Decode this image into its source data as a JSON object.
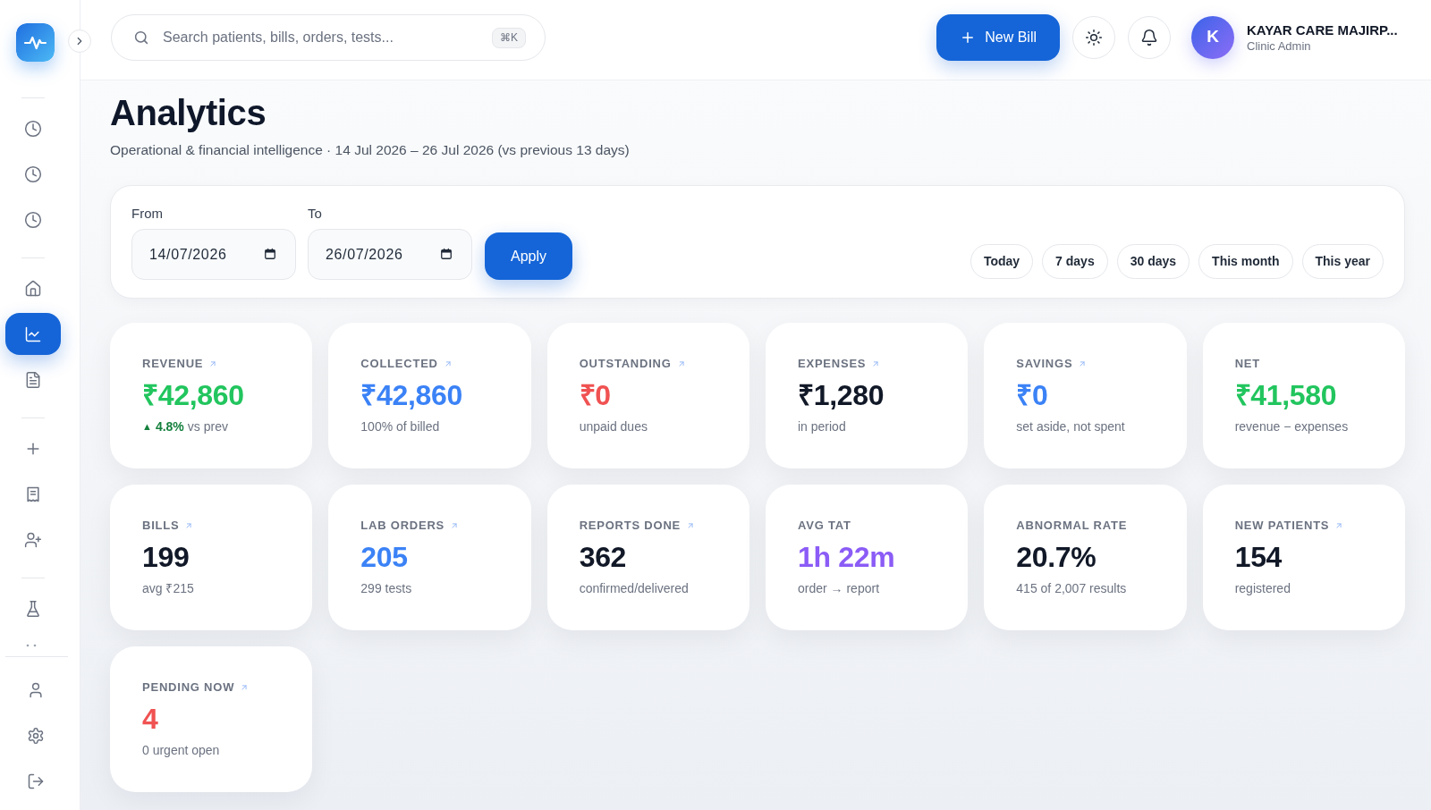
{
  "sidebar": {
    "groups": [
      {
        "items": [
          {
            "kind": "clock",
            "selected": false
          },
          {
            "kind": "clock",
            "selected": false
          },
          {
            "kind": "clock",
            "selected": false
          }
        ]
      },
      {
        "items": [
          {
            "kind": "home",
            "selected": false
          },
          {
            "kind": "chart",
            "selected": true
          },
          {
            "kind": "document",
            "selected": false
          }
        ]
      },
      {
        "items": [
          {
            "kind": "plus",
            "selected": false
          },
          {
            "kind": "receipt",
            "selected": false
          },
          {
            "kind": "adduser",
            "selected": false
          }
        ]
      },
      {
        "items": [
          {
            "kind": "flask",
            "selected": false
          }
        ]
      }
    ],
    "footer_items": [
      {
        "kind": "user",
        "selected": false
      },
      {
        "kind": "gear",
        "selected": false
      },
      {
        "kind": "logout",
        "selected": false
      }
    ]
  },
  "topbar": {
    "search": {
      "placeholder": "Search patients, bills, orders, tests...",
      "shortcut": "⌘K"
    },
    "new_bill_button": "New Bill",
    "user": {
      "initial": "K",
      "name": "KAYAR CARE MAJIRP...",
      "role": "Clinic Admin"
    }
  },
  "header": {
    "title": "Analytics",
    "subtitle": "Operational & financial intelligence · 14 Jul 2026 – 26 Jul 2026 (vs previous 13 days)"
  },
  "filters": {
    "from": {
      "label": "From",
      "value": "14/07/2026"
    },
    "to": {
      "label": "To",
      "value": "26/07/2026"
    },
    "apply_button": "Apply",
    "presets": [
      {
        "label": "Today",
        "selected": false
      },
      {
        "label": "7 days",
        "selected": false
      },
      {
        "label": "30 days",
        "selected": false
      },
      {
        "label": "This month",
        "selected": false
      },
      {
        "label": "This year",
        "selected": false
      }
    ]
  },
  "cards": [
    {
      "label": "REVENUE",
      "linked": true,
      "value": "₹42,860",
      "color": "#22c55e",
      "change": {
        "marker": "▲",
        "value": "4.8%"
      },
      "note": "vs prev"
    },
    {
      "label": "COLLECTED",
      "linked": true,
      "value": "₹42,860",
      "color": "#3b82f6",
      "note": "100% of billed"
    },
    {
      "label": "OUTSTANDING",
      "linked": true,
      "value": "₹0",
      "color": "#f05252",
      "note": "unpaid dues"
    },
    {
      "label": "EXPENSES",
      "linked": true,
      "value": "₹1,280",
      "color": "#111827",
      "note": "in period"
    },
    {
      "label": "SAVINGS",
      "linked": true,
      "value": "₹0",
      "color": "#3b82f6",
      "note": "set aside, not spent"
    },
    {
      "label": "NET",
      "linked": false,
      "value": "₹41,580",
      "color": "#22c55e",
      "note": "revenue − expenses"
    },
    {
      "label": "BILLS",
      "linked": true,
      "value": "199",
      "color": "#111827",
      "note": "avg ₹215"
    },
    {
      "label": "LAB ORDERS",
      "linked": true,
      "value": "205",
      "color": "#3b82f6",
      "note": "299 tests"
    },
    {
      "label": "REPORTS DONE",
      "linked": true,
      "value": "362",
      "color": "#111827",
      "note": "confirmed/delivered"
    },
    {
      "label": "AVG TAT",
      "linked": false,
      "value": "1h 22m",
      "color": "#8b5cf6",
      "note": "order → report"
    },
    {
      "label": "ABNORMAL RATE",
      "linked": false,
      "value": "20.7%",
      "color": "#111827",
      "note": "415 of 2,007 results"
    },
    {
      "label": "NEW PATIENTS",
      "linked": true,
      "value": "154",
      "color": "#111827",
      "note": "registered"
    },
    {
      "label": "PENDING NOW",
      "linked": true,
      "value": "4",
      "color": "#f05252",
      "note": "0 urgent open"
    }
  ]
}
